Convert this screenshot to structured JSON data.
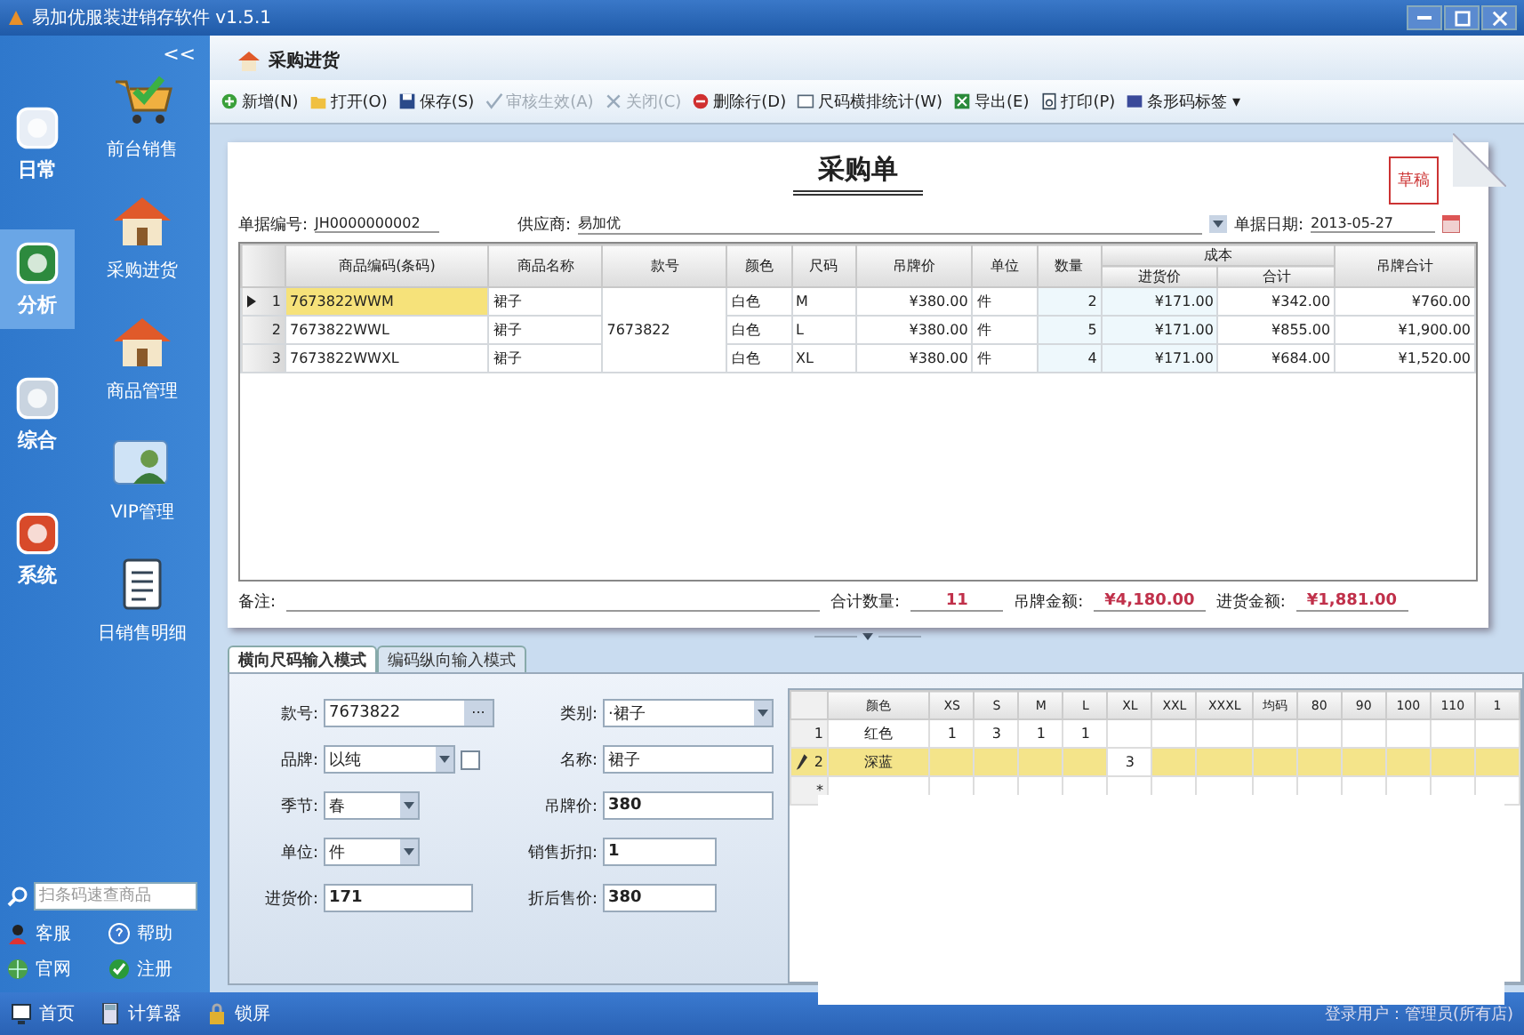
{
  "window": {
    "title": "易加优服装进销存软件 v1.5.1"
  },
  "sidebar": {
    "collapse": "<<",
    "categories": [
      {
        "label": "日常",
        "selected": false
      },
      {
        "label": "分析",
        "selected": true
      },
      {
        "label": "综合",
        "selected": false
      },
      {
        "label": "系统",
        "selected": false
      }
    ],
    "modules": [
      {
        "label": "前台销售",
        "kind": "cart"
      },
      {
        "label": "采购进货",
        "kind": "house"
      },
      {
        "label": "商品管理",
        "kind": "house"
      },
      {
        "label": "VIP管理",
        "kind": "card"
      },
      {
        "label": "日销售明细",
        "kind": "list"
      }
    ],
    "search": {
      "placeholder": "扫条码速查商品"
    },
    "links": [
      {
        "label": "客服",
        "kind": "person"
      },
      {
        "label": "帮助",
        "kind": "help"
      },
      {
        "label": "官网",
        "kind": "globe"
      },
      {
        "label": "注册",
        "kind": "check"
      }
    ]
  },
  "doc_tab": {
    "label": "采购进货"
  },
  "toolbar": [
    {
      "label": "新增(N)",
      "kind": "add",
      "disabled": false
    },
    {
      "label": "打开(O)",
      "kind": "open",
      "disabled": false
    },
    {
      "label": "保存(S)",
      "kind": "save",
      "disabled": false
    },
    {
      "label": "审核生效(A)",
      "kind": "check",
      "disabled": true
    },
    {
      "label": "关闭(C)",
      "kind": "close",
      "disabled": true
    },
    {
      "label": "删除行(D)",
      "kind": "delete",
      "disabled": false
    },
    {
      "label": "尺码横排统计(W)",
      "kind": "grid",
      "disabled": false
    },
    {
      "label": "导出(E)",
      "kind": "export",
      "disabled": false
    },
    {
      "label": "打印(P)",
      "kind": "print",
      "disabled": false
    },
    {
      "label": "条形码标签 ▾",
      "kind": "barcode",
      "disabled": false
    }
  ],
  "order": {
    "title": "采购单",
    "stamp": "草稿",
    "fields": [
      {
        "label": "单据编号:",
        "value": "JH0000000002"
      },
      {
        "label": "供应商:",
        "value": "易加优"
      },
      {
        "label": "单据日期:",
        "value": "2013-05-27"
      }
    ],
    "table": {
      "columns": [
        "商品编码(条码)",
        "商品名称",
        "款号",
        "颜色",
        "尺码",
        "吊牌价",
        "单位",
        "数量",
        "成本",
        "吊牌合计"
      ],
      "subcolumns": [
        "进货价",
        "合计"
      ],
      "style_no": "7673822",
      "rows": [
        {
          "index": "1",
          "selected": true,
          "code": "7673822WWM",
          "name": "裙子",
          "shade": "白色",
          "size": "M",
          "price": "¥380.00",
          "unit": "件",
          "qty": "2",
          "cost": "¥171.00",
          "cost_total": "¥342.00",
          "tag_total": "¥760.00"
        },
        {
          "index": "2",
          "selected": false,
          "code": "7673822WWL",
          "name": "裙子",
          "shade": "白色",
          "size": "L",
          "price": "¥380.00",
          "unit": "件",
          "qty": "5",
          "cost": "¥171.00",
          "cost_total": "¥855.00",
          "tag_total": "¥1,900.00"
        },
        {
          "index": "3",
          "selected": false,
          "code": "7673822WWXL",
          "name": "裙子",
          "shade": "白色",
          "size": "XL",
          "price": "¥380.00",
          "unit": "件",
          "qty": "4",
          "cost": "¥171.00",
          "cost_total": "¥684.00",
          "tag_total": "¥1,520.00"
        }
      ]
    },
    "remark": {
      "label": "备注:"
    },
    "totals": [
      {
        "label": "合计数量:",
        "value": "11"
      },
      {
        "label": "吊牌金额:",
        "value": "¥4,180.00"
      },
      {
        "label": "进货金额:",
        "value": "¥1,881.00"
      }
    ]
  },
  "input_tabs": [
    {
      "label": "横向尺码输入模式",
      "selected": true
    },
    {
      "label": "编码纵向输入模式",
      "selected": false
    }
  ],
  "item_form": [
    {
      "label": "款号:",
      "value": "7673822",
      "kind": "browse",
      "button": "..."
    },
    {
      "label": "类别:",
      "value": "·裙子",
      "kind": "select"
    },
    {
      "label": "品牌:",
      "value": "以纯",
      "kind": "select_check",
      "checked": false
    },
    {
      "label": "名称:",
      "value": "裙子",
      "kind": "text"
    },
    {
      "label": "季节:",
      "value": "春",
      "kind": "select"
    },
    {
      "label": "吊牌价:",
      "value": "380",
      "kind": "text"
    },
    {
      "label": "单位:",
      "value": "件",
      "kind": "select"
    },
    {
      "label": "销售折扣:",
      "value": "1",
      "kind": "text"
    },
    {
      "label": "进货价:",
      "value": "171",
      "kind": "text"
    },
    {
      "label": "折后售价:",
      "value": "380",
      "kind": "text"
    }
  ],
  "size_grid": {
    "columns": [
      "颜色",
      "XS",
      "S",
      "M",
      "L",
      "XL",
      "XXL",
      "XXXL",
      "均码",
      "80",
      "90",
      "100",
      "110",
      "1"
    ],
    "rows": [
      {
        "index": "1",
        "selected": false,
        "cells": [
          "红色",
          "1",
          "3",
          "1",
          "1",
          "",
          "",
          "",
          "",
          "",
          "",
          "",
          ""
        ]
      },
      {
        "index": "2",
        "selected": true,
        "cells": [
          "深蓝",
          "",
          "",
          "",
          "",
          "3",
          "",
          "",
          "",
          "",
          "",
          "",
          ""
        ]
      }
    ],
    "new_row": "*"
  },
  "status_bar": {
    "items": [
      {
        "label": "首页",
        "kind": "home"
      },
      {
        "label": "计算器",
        "kind": "calc"
      },
      {
        "label": "锁屏",
        "kind": "lock"
      }
    ],
    "user": "登录用户：管理员(所有店)"
  }
}
